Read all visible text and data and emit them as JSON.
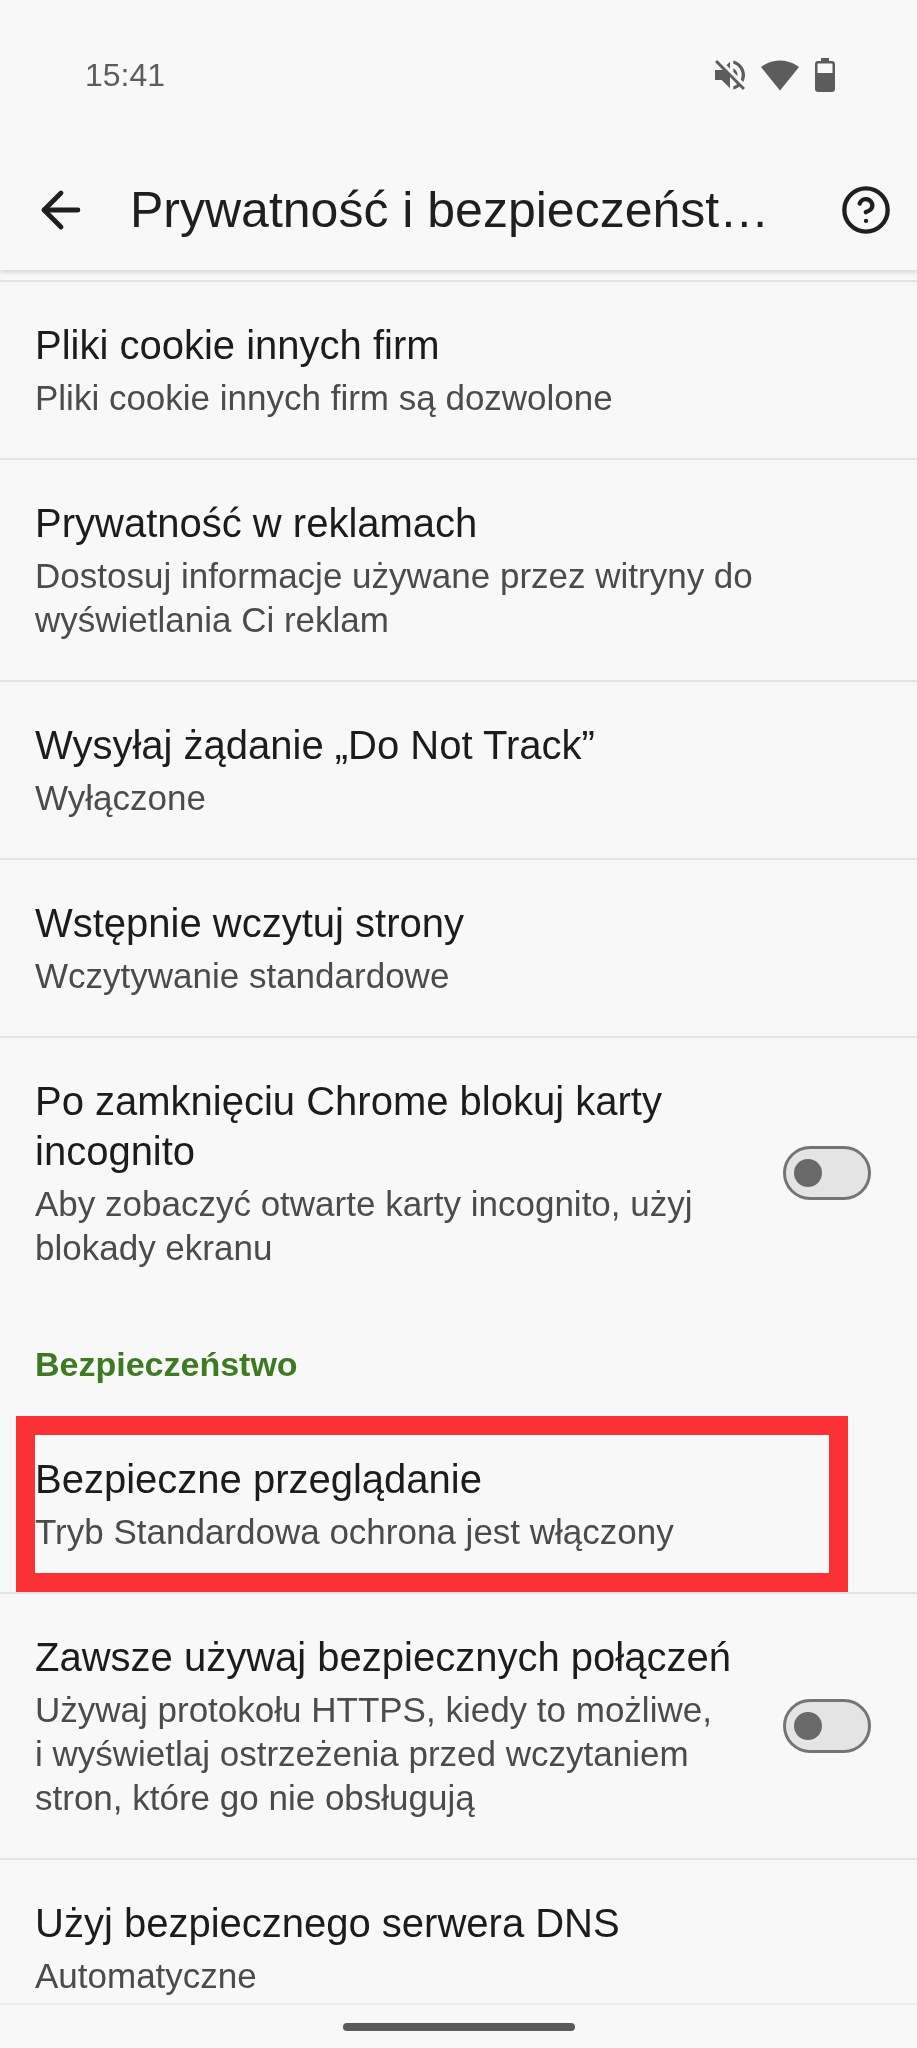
{
  "status_bar": {
    "time": "15:41"
  },
  "toolbar": {
    "title": "Prywatność i bezpieczeńst…"
  },
  "sections": [
    {
      "items": [
        {
          "kind": "link",
          "title": "Pliki cookie innych firm",
          "description": "Pliki cookie innych firm są dozwolone",
          "highlighted": false
        },
        {
          "kind": "link",
          "title": "Prywatność w reklamach",
          "description": "Dostosuj informacje używane przez witryny do wyświetlania Ci reklam",
          "highlighted": false
        },
        {
          "kind": "link",
          "title": "Wysyłaj żądanie „Do Not Track”",
          "description": "Wyłączone",
          "highlighted": false
        },
        {
          "kind": "link",
          "title": "Wstępnie wczytuj strony",
          "description": "Wczytywanie standardowe",
          "highlighted": false
        },
        {
          "kind": "switch",
          "title": "Po zamknięciu Chrome blokuj karty incognito",
          "description": "Aby zobaczyć otwarte karty incognito, użyj blokady ekranu",
          "on": false,
          "highlighted": false
        }
      ]
    },
    {
      "header": "Bezpieczeństwo",
      "items": [
        {
          "kind": "link",
          "title": "Bezpieczne przeglądanie",
          "description": "Tryb Standardowa ochrona jest włączony",
          "highlighted": true
        },
        {
          "kind": "switch",
          "title": "Zawsze używaj bezpiecznych połączeń",
          "description": "Używaj protokołu HTTPS, kiedy to możliwe, i wyświetlaj ostrzeżenia przed wczytaniem stron, które go nie obsługują",
          "on": false,
          "highlighted": false
        },
        {
          "kind": "link",
          "title": "Użyj bezpiecznego serwera DNS",
          "description": "Automatyczne",
          "highlighted": false
        }
      ]
    }
  ]
}
